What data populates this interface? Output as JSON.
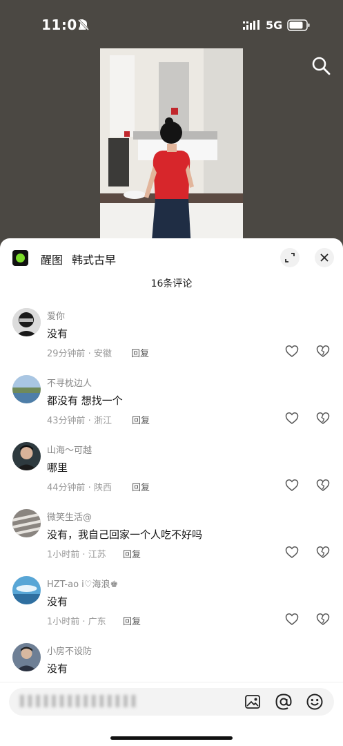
{
  "status_bar": {
    "time": "11:01",
    "network": "5G",
    "icons": [
      "bell-mute-icon",
      "signal-icon",
      "battery-icon"
    ]
  },
  "video": {
    "search_icon": "search-icon"
  },
  "sheet": {
    "app_name": "醒图",
    "filter_name": "韩式古早",
    "comment_count": "16条评论",
    "expand_icon": "expand-icon",
    "close_icon": "close-icon"
  },
  "comments": [
    {
      "user": "爱你",
      "text": "没有",
      "meta": "29分钟前 · 安徽",
      "reply": "回复"
    },
    {
      "user": "不寻枕边人",
      "text": "都没有  想找一个",
      "meta": "43分钟前 · 浙江",
      "reply": "回复"
    },
    {
      "user": "山海～可越",
      "text": "哪里",
      "meta": "44分钟前 · 陕西",
      "reply": "回复"
    },
    {
      "user": "微笑生活@",
      "text": "没有，我自己回家一个人吃不好吗",
      "meta": "1小时前 · 江苏",
      "reply": "回复"
    },
    {
      "user": "HZT-ao i♡海浪♚",
      "text": "没有",
      "meta": "1小时前 · 广东",
      "reply": "回复"
    },
    {
      "user": "小房不设防",
      "text": "没有",
      "meta": "",
      "reply": ""
    }
  ],
  "input": {
    "placeholder": "▌▌▌▌▌▌▌▌▌▌▌▌▌▌▌",
    "icons": [
      "image-icon",
      "at-icon",
      "emoji-icon"
    ]
  },
  "colors": {
    "video_bg": "#4b4843",
    "sheet_bg": "#ffffff",
    "logo_green": "#7bdc2a",
    "muted_text": "#888888"
  }
}
